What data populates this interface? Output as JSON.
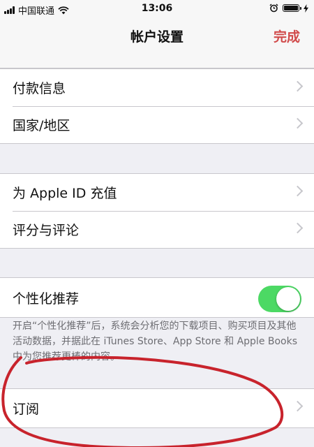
{
  "status_bar": {
    "carrier": "中国联通",
    "time": "13:06",
    "battery_level": 0.9
  },
  "nav": {
    "title": "帐户设置",
    "done_label": "完成"
  },
  "groups": {
    "payment": {
      "items": [
        {
          "label": "付款信息"
        },
        {
          "label": "国家/地区"
        }
      ]
    },
    "balance": {
      "items": [
        {
          "label": "为 Apple ID 充值"
        },
        {
          "label": "评分与评论"
        }
      ]
    },
    "personalization": {
      "label": "个性化推荐",
      "toggle_on": true,
      "footnote": "开启“个性化推荐”后，系统会分析您的下载项目、购买项目及其他活动数据，并据此在 iTunes Store、App Store 和 Apple Books 中为您推荐更棒的内容。"
    },
    "subscriptions": {
      "label": "订阅"
    }
  },
  "colors": {
    "accent": "#d14b4b",
    "toggle_on": "#4cd964",
    "annotation": "#c8232c"
  },
  "icons": {
    "signal": "cellular-signal-icon",
    "wifi": "wifi-icon",
    "alarm": "alarm-icon",
    "battery": "battery-icon",
    "charging": "charging-bolt-icon",
    "chevron": "chevron-right-icon"
  }
}
